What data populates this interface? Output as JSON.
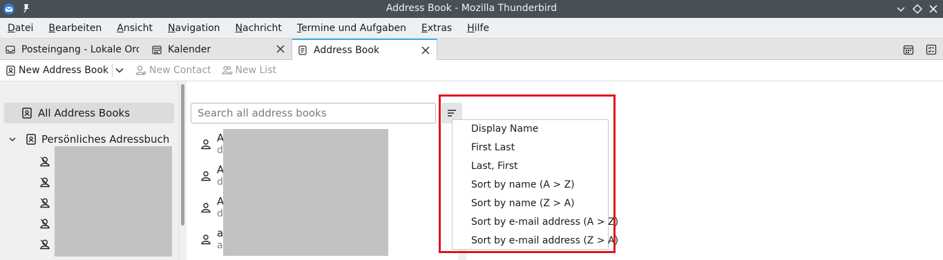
{
  "window": {
    "title": "Address Book - Mozilla Thunderbird"
  },
  "menubar": [
    "Datei",
    "Bearbeiten",
    "Ansicht",
    "Navigation",
    "Nachricht",
    "Termine und Aufgaben",
    "Extras",
    "Hilfe"
  ],
  "tabs": [
    {
      "label": "Posteingang - Lokale Ordne",
      "icon": "inbox-icon"
    },
    {
      "label": "Kalender",
      "icon": "calendar-icon"
    },
    {
      "label": "Address Book",
      "icon": "address-book-icon",
      "active": true
    }
  ],
  "toolbar": {
    "new_address_book": "New Address Book",
    "new_contact": "New Contact",
    "new_list": "New List"
  },
  "sidebar": {
    "all_address_books": "All Address Books",
    "book": "Persönliches Adressbuch"
  },
  "search": {
    "placeholder": "Search all address books"
  },
  "contacts": [
    {
      "name": "A",
      "sub": "d"
    },
    {
      "name": "A",
      "sub": "d"
    },
    {
      "name": "A",
      "sub": "d"
    },
    {
      "name": "a",
      "sub": "a"
    }
  ],
  "sort_menu": {
    "options": [
      "Display Name",
      "First Last",
      "Last, First",
      "Sort by name (A > Z)",
      "Sort by name (Z > A)",
      "Sort by e-mail address (A > Z)",
      "Sort by e-mail address (Z > A)"
    ]
  },
  "colors": {
    "accent": "#3daee9",
    "highlight": "#e0141e",
    "titlebar": "#475057"
  }
}
